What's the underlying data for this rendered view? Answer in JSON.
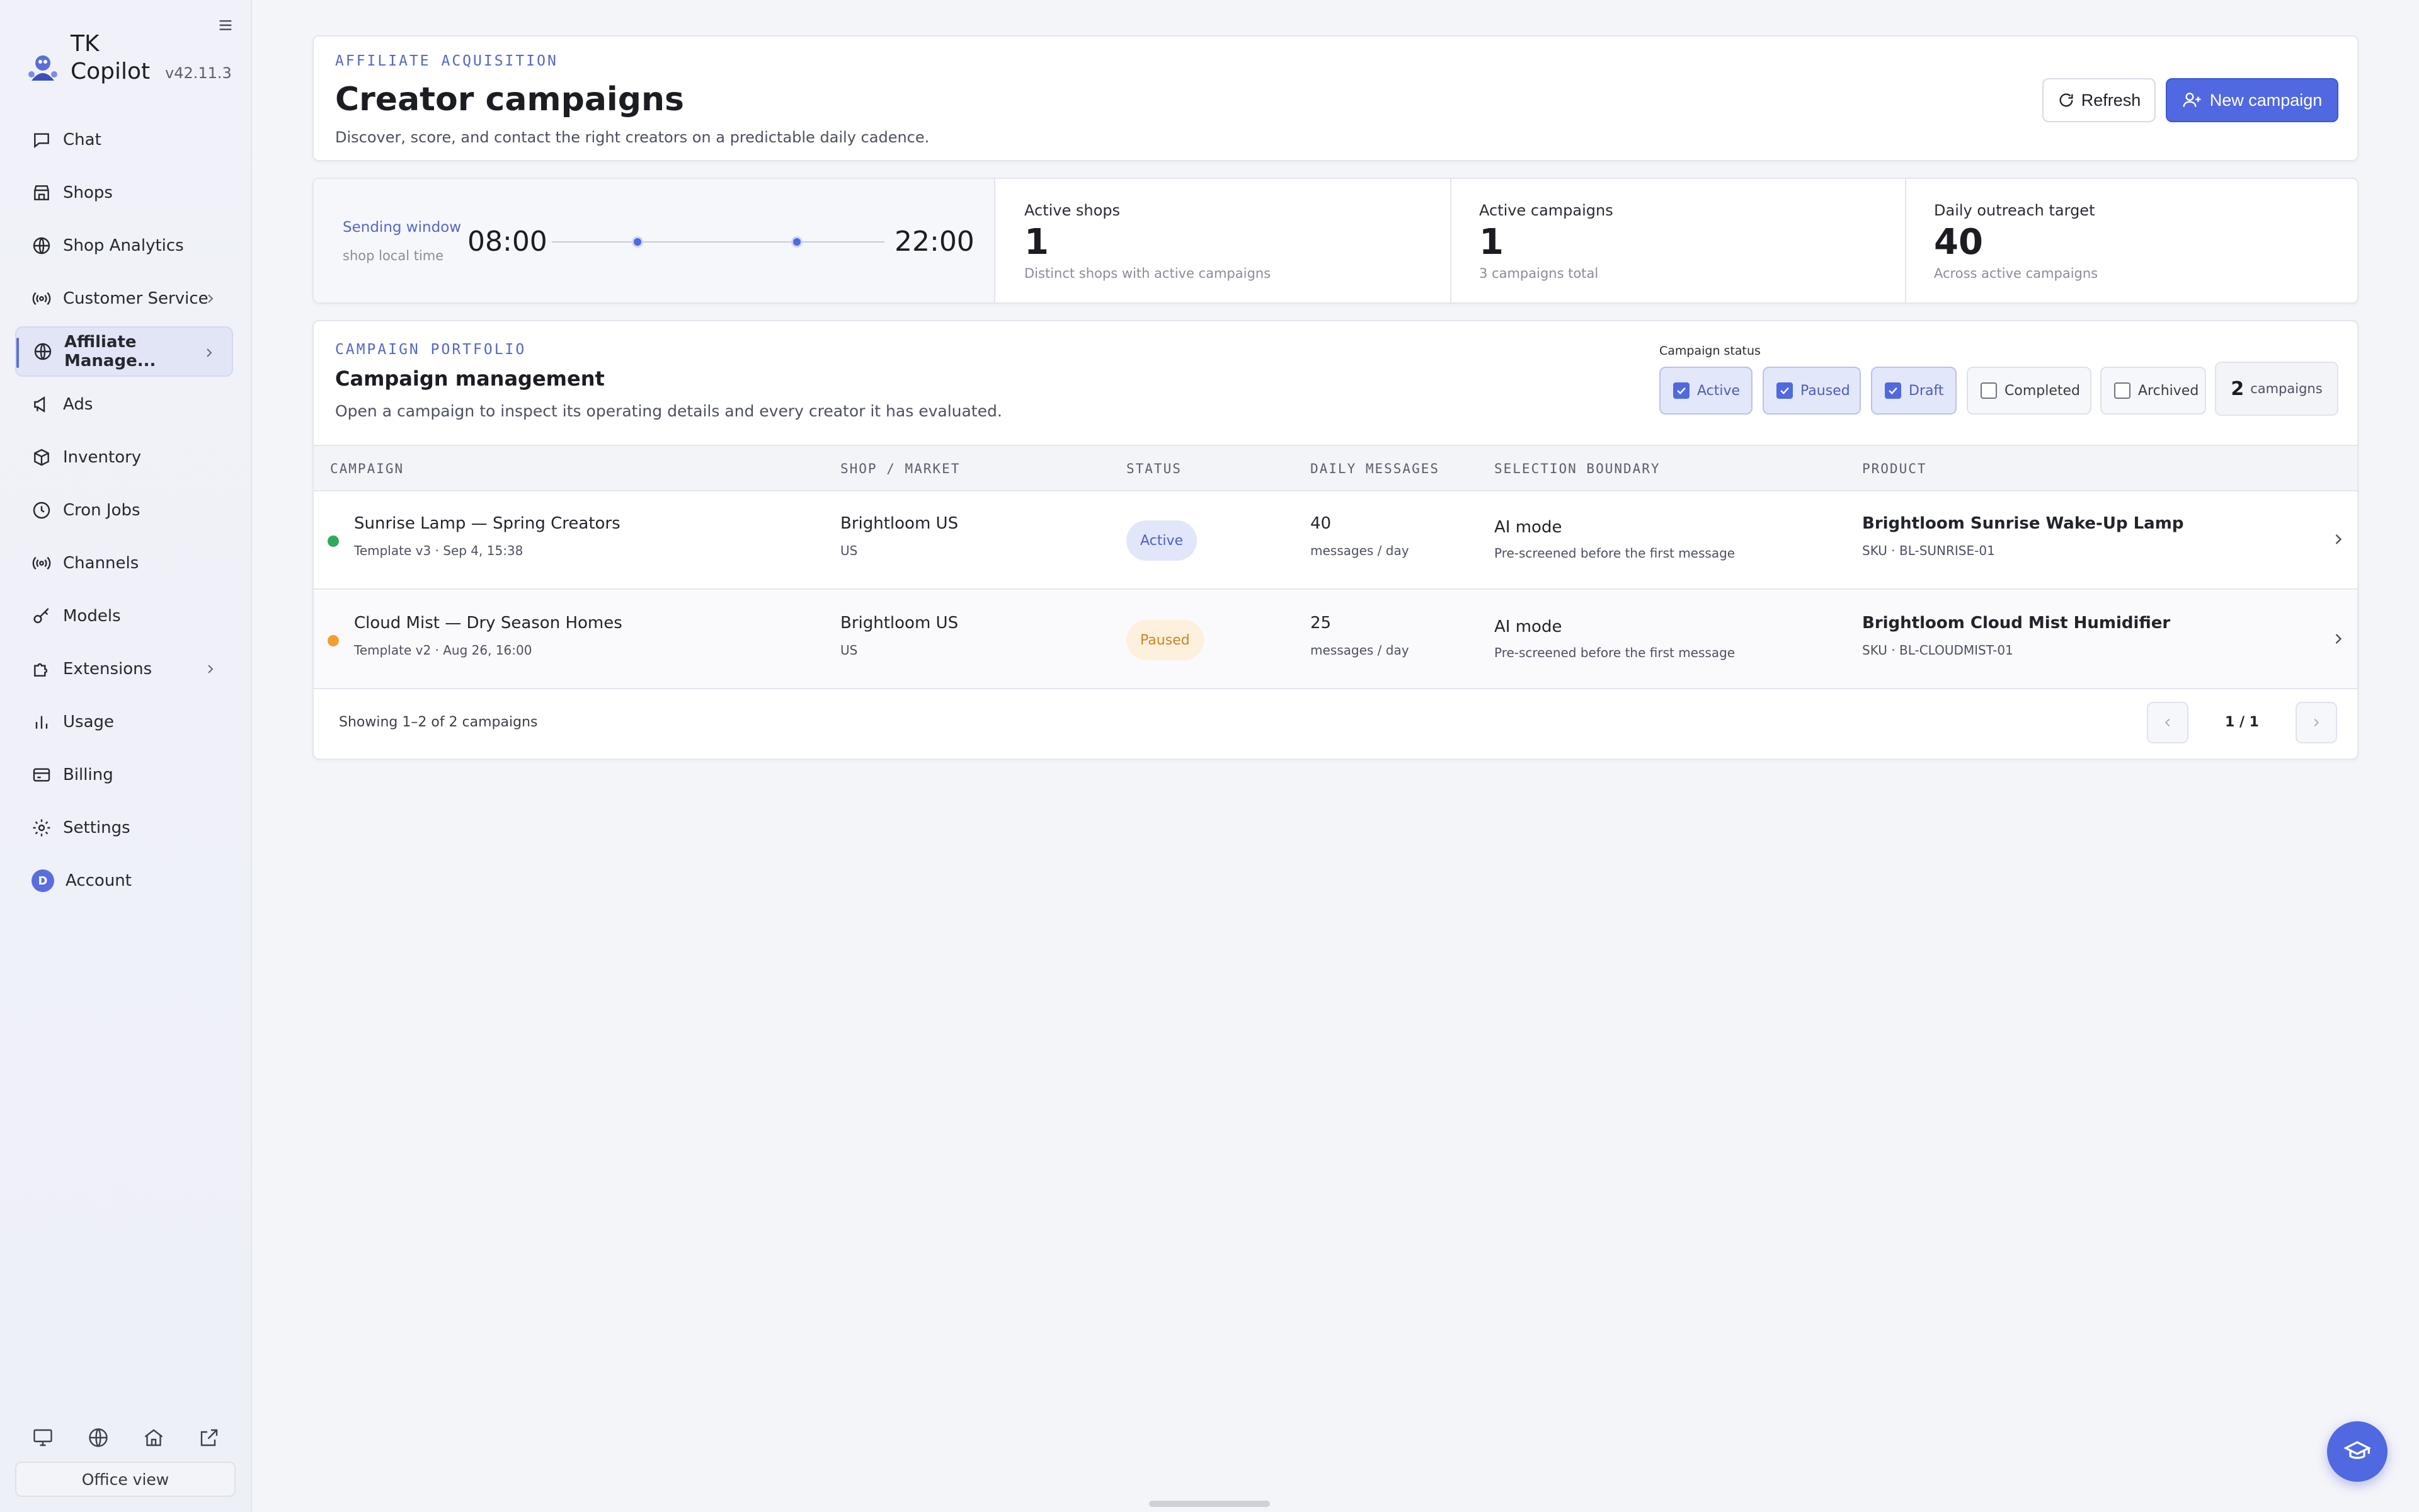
{
  "app": {
    "name": "TK Copilot",
    "version": "v42.11.3"
  },
  "sidebar": {
    "items": [
      {
        "label": "Chat",
        "icon": "chat-icon"
      },
      {
        "label": "Shops",
        "icon": "store-icon"
      },
      {
        "label": "Shop Analytics",
        "icon": "globe-icon"
      },
      {
        "label": "Customer Service",
        "icon": "broadcast-icon",
        "has_submenu": true
      },
      {
        "label": "Affiliate Manage...",
        "icon": "globe-icon",
        "has_submenu": true,
        "active": true
      },
      {
        "label": "Ads",
        "icon": "megaphone-icon"
      },
      {
        "label": "Inventory",
        "icon": "box-icon"
      },
      {
        "label": "Cron Jobs",
        "icon": "clock-icon"
      },
      {
        "label": "Channels",
        "icon": "broadcast-icon"
      },
      {
        "label": "Models",
        "icon": "key-icon"
      },
      {
        "label": "Extensions",
        "icon": "puzzle-icon",
        "has_submenu": true
      },
      {
        "label": "Usage",
        "icon": "bar-chart-icon"
      },
      {
        "label": "Billing",
        "icon": "credit-card-icon"
      },
      {
        "label": "Settings",
        "icon": "gear-icon"
      },
      {
        "label": "Account",
        "icon": "avatar",
        "avatar_letter": "D"
      }
    ],
    "office_view_label": "Office view"
  },
  "header": {
    "eyebrow": "AFFILIATE ACQUISITION",
    "title": "Creator campaigns",
    "subtitle": "Discover, score, and contact the right creators on a predictable daily cadence.",
    "refresh_label": "Refresh",
    "new_campaign_label": "New campaign"
  },
  "stats": {
    "sending_window": {
      "label": "Sending window",
      "sub": "shop local time",
      "start": "08:00",
      "end": "22:00"
    },
    "cards": [
      {
        "label": "Active shops",
        "value": "1",
        "note": "Distinct shops with active campaigns"
      },
      {
        "label": "Active campaigns",
        "value": "1",
        "note": "3 campaigns total"
      },
      {
        "label": "Daily outreach target",
        "value": "40",
        "note": "Across active campaigns"
      }
    ]
  },
  "portfolio": {
    "eyebrow": "CAMPAIGN PORTFOLIO",
    "title": "Campaign management",
    "subtitle": "Open a campaign to inspect its operating details and every creator it has evaluated.",
    "filter_label": "Campaign status",
    "filters": [
      {
        "label": "Active",
        "checked": true
      },
      {
        "label": "Paused",
        "checked": true
      },
      {
        "label": "Draft",
        "checked": true
      },
      {
        "label": "Completed",
        "checked": false
      },
      {
        "label": "Archived",
        "checked": false
      }
    ],
    "count": "2",
    "count_label": "campaigns",
    "columns": [
      "CAMPAIGN",
      "SHOP / MARKET",
      "STATUS",
      "DAILY MESSAGES",
      "SELECTION BOUNDARY",
      "PRODUCT"
    ],
    "rows": [
      {
        "name": "Sunrise Lamp — Spring Creators",
        "meta": "Template v3 · Sep 4, 15:38",
        "shop": "Brightloom US",
        "market": "US",
        "status": "Active",
        "daily": "40",
        "daily_unit": "messages / day",
        "boundary": "AI mode",
        "boundary_note": "Pre-screened before the first message",
        "product": "Brightloom Sunrise Wake-Up Lamp",
        "sku": "SKU · BL-SUNRISE-01",
        "dot_color": "#2faa5a"
      },
      {
        "name": "Cloud Mist — Dry Season Homes",
        "meta": "Template v2 · Aug 26, 16:00",
        "shop": "Brightloom US",
        "market": "US",
        "status": "Paused",
        "daily": "25",
        "daily_unit": "messages / day",
        "boundary": "AI mode",
        "boundary_note": "Pre-screened before the first message",
        "product": "Brightloom Cloud Mist Humidifier",
        "sku": "SKU · BL-CLOUDMIST-01",
        "dot_color": "#f0a033"
      }
    ],
    "footer_text": "Showing 1–2 of 2 campaigns",
    "page_text": "1 / 1"
  },
  "colors": {
    "accent": "#5069e0",
    "active_status": "#4f60c4",
    "paused_status": "#c9842b"
  }
}
